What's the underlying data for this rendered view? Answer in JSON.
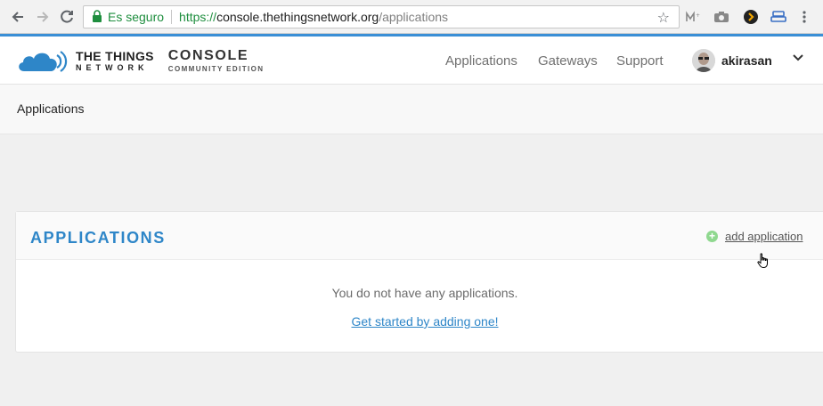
{
  "browser": {
    "secure_label": "Es seguro",
    "url_scheme": "https://",
    "url_host": "console.thethingsnetwork.org",
    "url_path": "/applications"
  },
  "header": {
    "brand_line1": "THE THINGS",
    "brand_line2": "NETWORK",
    "console_line1": "CONSOLE",
    "console_line2": "COMMUNITY EDITION",
    "nav": [
      "Applications",
      "Gateways",
      "Support"
    ],
    "username": "akirasan"
  },
  "breadcrumb": "Applications",
  "card": {
    "title": "APPLICATIONS",
    "add_label": "add application",
    "empty_text": "You do not have any applications.",
    "cta_label": "Get started by adding one!"
  },
  "colors": {
    "accent_blue": "#2e86c8",
    "stripe_blue": "#3a8fd6",
    "secure_green": "#1e8e3e",
    "add_green": "#8fd88f"
  }
}
